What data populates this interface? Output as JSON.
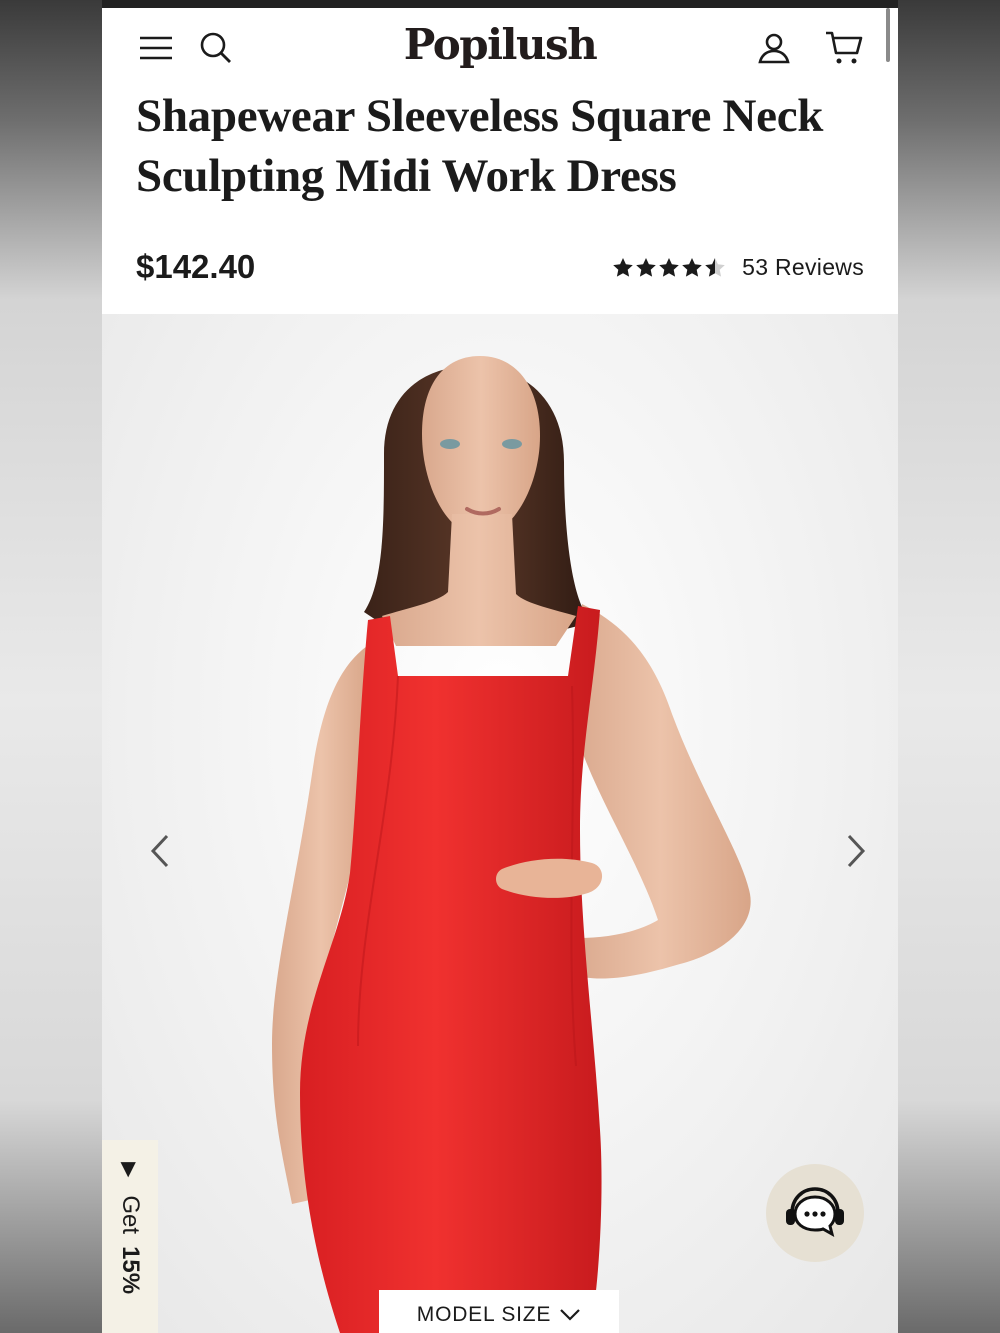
{
  "header": {
    "logo": "Popilush",
    "menu_icon": "hamburger-menu-icon",
    "search_icon": "search-icon",
    "account_icon": "user-icon",
    "cart_icon": "shopping-cart-icon"
  },
  "product": {
    "title": "Shapewear Sleeveless Square Neck Sculpting Midi Work Dress",
    "price": "$142.40",
    "rating": 4.5,
    "reviews_label": "53 Reviews"
  },
  "gallery": {
    "prev_icon": "chevron-left-icon",
    "next_icon": "chevron-right-icon",
    "model_size_label": "MODEL SIZE"
  },
  "promo": {
    "label": "Get",
    "discount": "15%"
  },
  "chat": {
    "icon": "chat-support-icon"
  },
  "colors": {
    "dress": "#e8282b",
    "promo_bg": "#f4f1e6",
    "chat_bg": "#e6e0d3"
  }
}
